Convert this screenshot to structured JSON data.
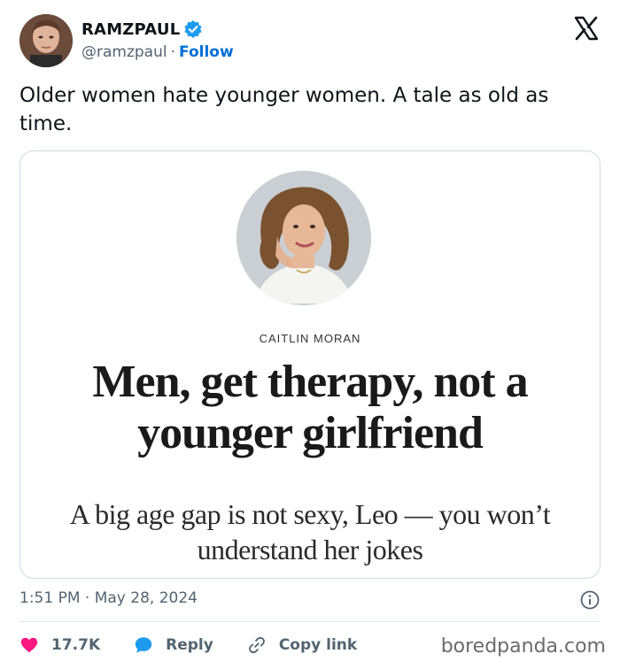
{
  "author": {
    "display_name": "RAMZPAUL",
    "handle": "@ramzpaul",
    "separator": "·",
    "follow_label": "Follow",
    "verified": true
  },
  "tweet": {
    "text": "Older women hate younger women. A tale as old as time."
  },
  "card": {
    "byline": "CAITLIN MORAN",
    "headline": "Men, get therapy, not a younger girlfriend",
    "subhead": "A big age gap is not sexy, Leo — you won’t understand her jokes"
  },
  "meta": {
    "timestamp": "1:51 PM · May 28, 2024"
  },
  "actions": {
    "like_count": "17.7K",
    "reply_label": "Reply",
    "copy_link_label": "Copy link"
  },
  "watermark": "boredpanda.com",
  "colors": {
    "accent": "#006fd6",
    "like": "#f91880",
    "verified": "#1d9bf0",
    "muted": "#536471"
  }
}
